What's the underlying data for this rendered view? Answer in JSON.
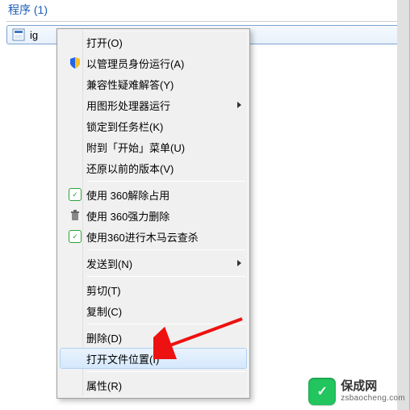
{
  "section": {
    "header": "程序 (1)"
  },
  "result": {
    "label": "ig",
    "icon": "app-icon"
  },
  "menu": {
    "items": [
      {
        "label": "打开(O)",
        "icon": null,
        "submenu": false
      },
      {
        "label": "以管理员身份运行(A)",
        "icon": "shield",
        "submenu": false
      },
      {
        "label": "兼容性疑难解答(Y)",
        "icon": null,
        "submenu": false
      },
      {
        "label": "用图形处理器运行",
        "icon": null,
        "submenu": true
      },
      {
        "label": "锁定到任务栏(K)",
        "icon": null,
        "submenu": false
      },
      {
        "label": "附到「开始」菜单(U)",
        "icon": null,
        "submenu": false
      },
      {
        "label": "还原以前的版本(V)",
        "icon": null,
        "submenu": false
      },
      {
        "sep": true
      },
      {
        "label": "使用 360解除占用",
        "icon": "360",
        "submenu": false
      },
      {
        "label": "使用 360强力删除",
        "icon": "trash",
        "submenu": false
      },
      {
        "label": "使用360进行木马云查杀",
        "icon": "360",
        "submenu": false
      },
      {
        "sep": true
      },
      {
        "label": "发送到(N)",
        "icon": null,
        "submenu": true
      },
      {
        "sep": true
      },
      {
        "label": "剪切(T)",
        "icon": null,
        "submenu": false
      },
      {
        "label": "复制(C)",
        "icon": null,
        "submenu": false
      },
      {
        "sep": true
      },
      {
        "label": "删除(D)",
        "icon": null,
        "submenu": false
      },
      {
        "label": "打开文件位置(I)",
        "icon": null,
        "submenu": false,
        "highlight": true
      },
      {
        "sep": true
      },
      {
        "label": "属性(R)",
        "icon": null,
        "submenu": false
      }
    ]
  },
  "watermark": {
    "cn": "保成网",
    "en": "zsbaocheng.com",
    "logo_glyph": "✓"
  }
}
